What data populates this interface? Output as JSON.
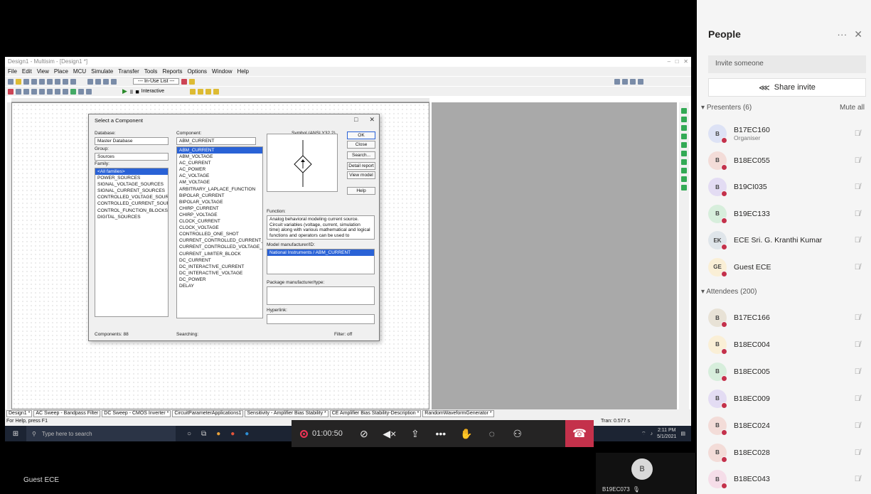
{
  "app": {
    "title": "Design1 - Multisim - [Design1 *]",
    "menu": [
      "File",
      "Edit",
      "View",
      "Place",
      "MCU",
      "Simulate",
      "Transfer",
      "Tools",
      "Reports",
      "Options",
      "Window",
      "Help"
    ],
    "inuse": "--- In-Use List ---",
    "interactive": "Interactive",
    "tabs": [
      "Design1 *",
      "AC Sweep - Bandpass Filter",
      "DC Sweep - CMOS Inverter *",
      "CircuitParameterApplications1",
      "Sensitivity - Amplifier Bias Stability *",
      "CE Amplifier Bias Stability-Description *",
      "RandomWaveformGenerator *"
    ],
    "status_left": "For Help, press F1",
    "status_right": "Tran: 0.577 s"
  },
  "dialog": {
    "title": "Select a Component",
    "database_label": "Database:",
    "database_value": "Master Database",
    "group_label": "Group:",
    "group_value": "Sources",
    "family_label": "Family:",
    "families": [
      "<All families>",
      "POWER_SOURCES",
      "SIGNAL_VOLTAGE_SOURCES",
      "SIGNAL_CURRENT_SOURCES",
      "CONTROLLED_VOLTAGE_SOUR",
      "CONTROLLED_CURRENT_SOUR",
      "CONTROL_FUNCTION_BLOCKS",
      "DIGITAL_SOURCES"
    ],
    "component_label": "Component:",
    "component_value": "ABM_CURRENT",
    "components": [
      "ABM_CURRENT",
      "ABM_VOLTAGE",
      "AC_CURRENT",
      "AC_POWER",
      "AC_VOLTAGE",
      "AM_VOLTAGE",
      "ARBITRARY_LAPLACE_FUNCTION",
      "BIPOLAR_CURRENT",
      "BIPOLAR_VOLTAGE",
      "CHIRP_CURRENT",
      "CHIRP_VOLTAGE",
      "CLOCK_CURRENT",
      "CLOCK_VOLTAGE",
      "CONTROLLED_ONE_SHOT",
      "CURRENT_CONTROLLED_CURRENT_S",
      "CURRENT_CONTROLLED_VOLTAGE_S",
      "CURRENT_LIMITER_BLOCK",
      "DC_CURRENT",
      "DC_INTERACTIVE_CURRENT",
      "DC_INTERACTIVE_VOLTAGE",
      "DC_POWER",
      "DELAY"
    ],
    "symbol_label": "Symbol (ANSI Y32.2)",
    "function_label": "Function:",
    "function_text": "Analog behavioral modeling current source. Circuit variables (voltage, current, simulation time) along with various mathematical and logical functions and operators can be used to",
    "model_label": "Model manufacturer/ID:",
    "model_value": "National Instruments / ABM_CURRENT",
    "package_label": "Package manufacturer/type:",
    "hyperlink_label": "Hyperlink:",
    "buttons": [
      "OK",
      "Close",
      "Search...",
      "Detail report",
      "View model",
      "Help"
    ],
    "components_count": "Components: 88",
    "searching": "Searching:",
    "filter": "Filter: off"
  },
  "taskbar": {
    "search_placeholder": "Type here to search",
    "time": "2:11 PM",
    "date": "5/1/2021"
  },
  "call": {
    "timer": "01:00:50",
    "self_name": "Guest ECE",
    "tile_initial": "B",
    "tile_name": "B19EC073"
  },
  "people": {
    "title": "People",
    "invite_placeholder": "Invite someone",
    "share_label": "Share invite",
    "presenters_label": "Presenters (6)",
    "mute_all": "Mute all",
    "attendees_label": "Attendees (200)",
    "presenters": [
      {
        "initials": "B",
        "name": "B17EC160",
        "role": "Organiser",
        "color": "#dde2f5"
      },
      {
        "initials": "B",
        "name": "B18EC055",
        "color": "#f3dcd8"
      },
      {
        "initials": "B",
        "name": "B19CI035",
        "color": "#e3dcf3"
      },
      {
        "initials": "B",
        "name": "B19EC133",
        "color": "#d7eedc"
      },
      {
        "initials": "EK",
        "name": "ECE Sri. G. Kranthi Kumar",
        "color": "#dfe5ea"
      },
      {
        "initials": "GE",
        "name": "Guest ECE",
        "color": "#faefd6"
      }
    ],
    "attendees": [
      {
        "initials": "B",
        "name": "B17EC166",
        "color": "#e8e2d6"
      },
      {
        "initials": "B",
        "name": "B18EC004",
        "color": "#faefd6"
      },
      {
        "initials": "B",
        "name": "B18EC005",
        "color": "#d7eedc"
      },
      {
        "initials": "B",
        "name": "B18EC009",
        "color": "#e3dcf3"
      },
      {
        "initials": "B",
        "name": "B18EC024",
        "color": "#f3dcd8"
      },
      {
        "initials": "B",
        "name": "B18EC028",
        "color": "#f3dcd8"
      },
      {
        "initials": "B",
        "name": "B18EC043",
        "color": "#f5dde8"
      }
    ]
  }
}
